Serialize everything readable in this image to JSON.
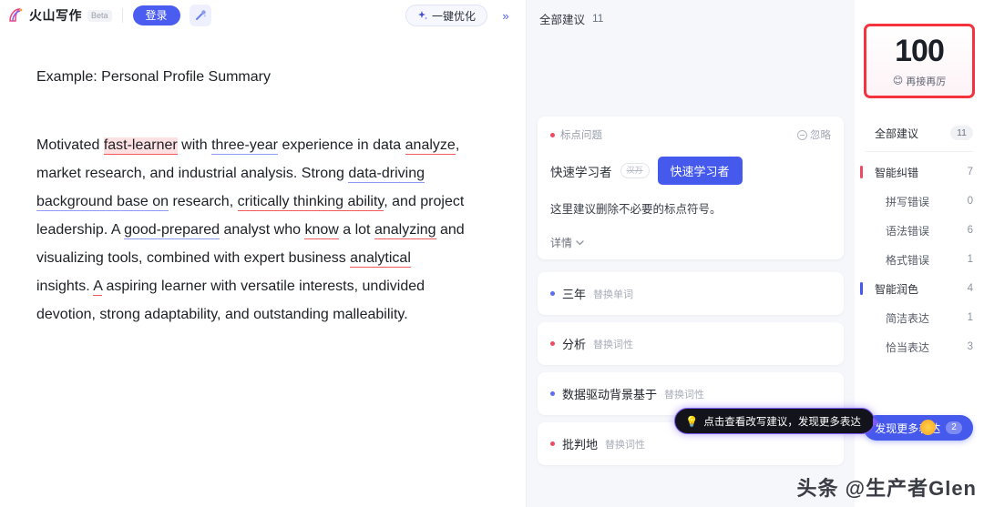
{
  "topbar": {
    "brand_name": "火山写作",
    "beta_label": "Beta",
    "login_label": "登录",
    "magic_icon": "magic-wand-icon",
    "optimize_label": "一键优化",
    "optimize_icon": "sparkle-icon",
    "collapse_icon": "double-chevron-right-icon"
  },
  "document": {
    "title": "Example: Personal Profile Summary",
    "segments": [
      {
        "text": "Motivated ",
        "mark": "none"
      },
      {
        "text": "fast-learner",
        "mark": "red-highlight"
      },
      {
        "text": " with ",
        "mark": "none"
      },
      {
        "text": "three-year",
        "mark": "blue"
      },
      {
        "text": " experience in data ",
        "mark": "none"
      },
      {
        "text": "analyze",
        "mark": "red"
      },
      {
        "text": ", market research, and industrial analysis. Strong ",
        "mark": "none"
      },
      {
        "text": "data-driving background base on",
        "mark": "blue"
      },
      {
        "text": " research, ",
        "mark": "none"
      },
      {
        "text": "critically thinking ability",
        "mark": "red"
      },
      {
        "text": ", and project leadership. A ",
        "mark": "none"
      },
      {
        "text": "good-prepared",
        "mark": "blue"
      },
      {
        "text": " analyst who ",
        "mark": "none"
      },
      {
        "text": "know",
        "mark": "red"
      },
      {
        "text": " a lot ",
        "mark": "none"
      },
      {
        "text": "analyzing",
        "mark": "red"
      },
      {
        "text": " and visualizing tools, combined with expert business ",
        "mark": "none"
      },
      {
        "text": "analytical",
        "mark": "red"
      },
      {
        "text": " insights. ",
        "mark": "none"
      },
      {
        "text": "A",
        "mark": "red"
      },
      {
        "text": " aspiring learner with versatile interests, undivided devotion, strong adaptability, and outstanding malleability.",
        "mark": "none"
      }
    ]
  },
  "suggestions_panel": {
    "header_label": "全部建议",
    "header_count": "11",
    "card": {
      "tag": "标点问题",
      "ignore_label": "忽略",
      "ignore_icon": "minus-circle-icon",
      "original": "快速学习者",
      "arrow_label": "汉万",
      "replacement": "快速学习者",
      "description": "这里建议删除不必要的标点符号。",
      "detail_label": "详情",
      "detail_icon": "chevron-down-icon"
    },
    "rows": [
      {
        "word": "三年",
        "kind": "替换单词",
        "dot": "blue"
      },
      {
        "word": "分析",
        "kind": "替换词性",
        "dot": "red"
      },
      {
        "word": "数据驱动背景基于",
        "kind": "替换词性",
        "dot": "blue"
      },
      {
        "word": "批判地",
        "kind": "替换词性",
        "dot": "red"
      }
    ],
    "tooltip": {
      "icon": "lightbulb-icon",
      "text": "点击查看改写建议，发现更多表达"
    }
  },
  "sidebar": {
    "score": {
      "value": "100",
      "emoji": "grinning-face-emoji",
      "label": "再接再厉",
      "border_color": "#f5333f"
    },
    "items": [
      {
        "label": "全部建议",
        "count": "11",
        "accent": "none",
        "level": "top",
        "badge": "pill"
      },
      {
        "label": "智能纠错",
        "count": "7",
        "accent": "red",
        "level": "top",
        "badge": "plain"
      },
      {
        "label": "拼写错误",
        "count": "0",
        "accent": "none",
        "level": "sub",
        "badge": "plain"
      },
      {
        "label": "语法错误",
        "count": "6",
        "accent": "none",
        "level": "sub",
        "badge": "plain"
      },
      {
        "label": "格式错误",
        "count": "1",
        "accent": "none",
        "level": "sub",
        "badge": "plain"
      },
      {
        "label": "智能润色",
        "count": "4",
        "accent": "blue",
        "level": "top",
        "badge": "plain"
      },
      {
        "label": "简洁表达",
        "count": "1",
        "accent": "none",
        "level": "sub",
        "badge": "plain"
      },
      {
        "label": "恰当表达",
        "count": "3",
        "accent": "none",
        "level": "sub",
        "badge": "plain"
      }
    ],
    "discover": {
      "label": "发现更多表达",
      "count": "2"
    }
  },
  "watermark": {
    "text": "头条 @生产者Glen"
  }
}
